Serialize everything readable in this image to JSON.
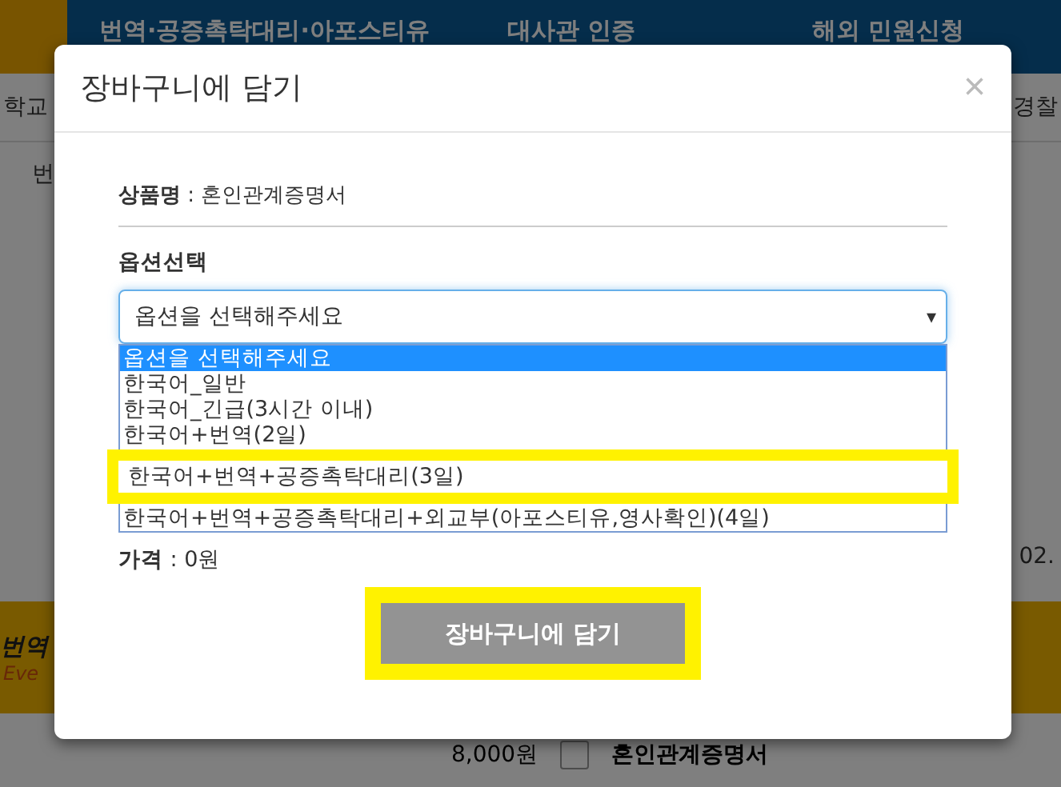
{
  "background": {
    "nav": [
      "번역·공증촉탁대리·아포스티유",
      "대사관 인증",
      "해외 민원신청"
    ],
    "subnav_left": "학교",
    "subnav_right": "경찰",
    "row_left": "번",
    "date_fragment": "02.",
    "banner_title": "번역",
    "banner_sub": "Eve",
    "price": "8,000원",
    "product_checkbox": {
      "checked": false,
      "label": "혼인관계증명서"
    }
  },
  "modal": {
    "title": "장바구니에 담기",
    "close": "×",
    "product_label": "상품명",
    "separator": ":",
    "product_value": "혼인관계증명서",
    "option_heading": "옵션선택",
    "select": {
      "value": "옵션을 선택해주세요",
      "arrow": "▾"
    },
    "options": [
      {
        "label": "옵션을 선택해주세요",
        "selected": true,
        "highlighted": false
      },
      {
        "label": "한국어_일반",
        "selected": false,
        "highlighted": false
      },
      {
        "label": "한국어_긴급(3시간 이내)",
        "selected": false,
        "highlighted": false
      },
      {
        "label": "한국어+번역(2일)",
        "selected": false,
        "highlighted": false
      },
      {
        "label": "한국어+번역+공증촉탁대리(3일)",
        "selected": false,
        "highlighted": true
      },
      {
        "label": "한국어+번역+공증촉탁대리+외교부(아포스티유,영사확인)(4일)",
        "selected": false,
        "highlighted": false
      }
    ],
    "price_label": "가격",
    "price_separator": ":",
    "price_value": "0원",
    "submit": {
      "label": "장바구니에 담기",
      "highlighted": true
    }
  }
}
